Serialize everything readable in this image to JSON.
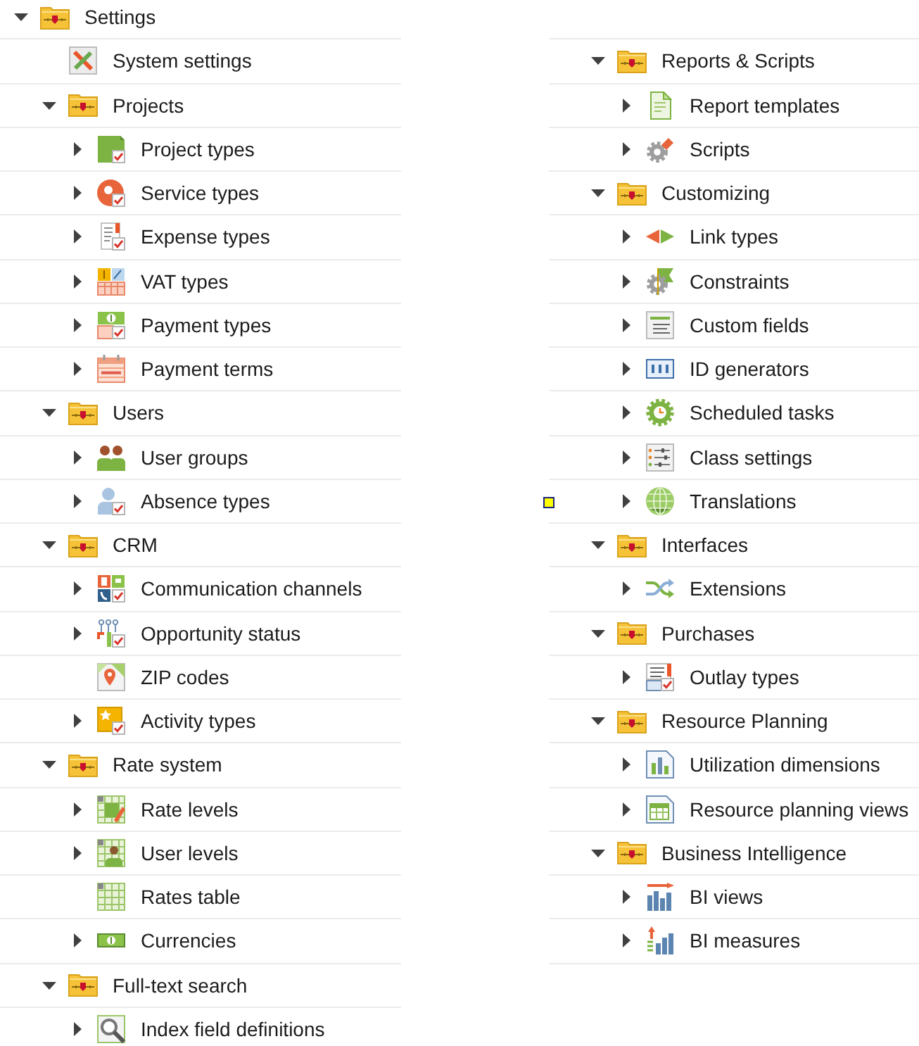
{
  "tree": {
    "label": "Settings",
    "kind": "folder",
    "expanded": true,
    "children": [
      {
        "label": "System settings",
        "kind": "tools"
      },
      {
        "label": "Projects",
        "kind": "folder",
        "expanded": true,
        "children": [
          {
            "label": "Project types",
            "kind": "tile",
            "expanded": false
          },
          {
            "label": "Service types",
            "kind": "pie",
            "expanded": false
          },
          {
            "label": "Expense types",
            "kind": "ledger",
            "expanded": false
          },
          {
            "label": "VAT types",
            "kind": "tax",
            "expanded": false
          },
          {
            "label": "Payment types",
            "kind": "payment",
            "expanded": false
          },
          {
            "label": "Payment terms",
            "kind": "calendar",
            "expanded": false
          }
        ]
      },
      {
        "label": "Users",
        "kind": "folder",
        "expanded": true,
        "children": [
          {
            "label": "User groups",
            "kind": "group",
            "expanded": false
          },
          {
            "label": "Absence types",
            "kind": "absence",
            "expanded": false
          }
        ]
      },
      {
        "label": "CRM",
        "kind": "folder",
        "expanded": true,
        "children": [
          {
            "label": "Communication channels",
            "kind": "channels",
            "expanded": false
          },
          {
            "label": "Opportunity status",
            "kind": "flow",
            "expanded": false
          },
          {
            "label": "ZIP codes",
            "kind": "map"
          },
          {
            "label": "Activity types",
            "kind": "star",
            "expanded": false
          }
        ]
      },
      {
        "label": "Rate system",
        "kind": "folder",
        "expanded": true,
        "children": [
          {
            "label": "Rate levels",
            "kind": "pencilgrid",
            "expanded": false
          },
          {
            "label": "User levels",
            "kind": "persongrid",
            "expanded": false
          },
          {
            "label": "Rates table",
            "kind": "grid"
          },
          {
            "label": "Currencies",
            "kind": "money",
            "expanded": false
          }
        ]
      },
      {
        "label": "Full-text search",
        "kind": "folder",
        "expanded": true,
        "children": [
          {
            "label": "Index field definitions",
            "kind": "magnifier",
            "expanded": false
          }
        ]
      },
      {
        "label": "Reports & Scripts",
        "kind": "folder",
        "expanded": true,
        "children": [
          {
            "label": "Report templates",
            "kind": "document",
            "expanded": false
          },
          {
            "label": "Scripts",
            "kind": "script",
            "expanded": false
          }
        ]
      },
      {
        "label": "Customizing",
        "kind": "folder",
        "expanded": true,
        "children": [
          {
            "label": "Link types",
            "kind": "link",
            "expanded": false
          },
          {
            "label": "Constraints",
            "kind": "constraint",
            "expanded": false
          },
          {
            "label": "Custom fields",
            "kind": "form",
            "expanded": false
          },
          {
            "label": "ID generators",
            "kind": "counter",
            "expanded": false
          },
          {
            "label": "Scheduled tasks",
            "kind": "schedule",
            "expanded": false
          },
          {
            "label": "Class settings",
            "kind": "sliders",
            "expanded": false
          },
          {
            "label": "Translations",
            "kind": "globe",
            "expanded": false
          }
        ]
      },
      {
        "label": "Interfaces",
        "kind": "folder",
        "expanded": true,
        "children": [
          {
            "label": "Extensions",
            "kind": "shuffle",
            "expanded": false
          }
        ]
      },
      {
        "label": "Purchases",
        "kind": "folder",
        "expanded": true,
        "children": [
          {
            "label": "Outlay types",
            "kind": "outlay",
            "expanded": false
          }
        ]
      },
      {
        "label": "Resource Planning",
        "kind": "folder",
        "expanded": true,
        "children": [
          {
            "label": "Utilization dimensions",
            "kind": "chart",
            "expanded": false
          },
          {
            "label": "Resource planning views",
            "kind": "planner",
            "expanded": false
          }
        ]
      },
      {
        "label": "Business Intelligence",
        "kind": "folder",
        "expanded": true,
        "children": [
          {
            "label": "BI views",
            "kind": "biview",
            "expanded": false
          },
          {
            "label": "BI measures",
            "kind": "bimeasure",
            "expanded": false
          }
        ]
      }
    ]
  }
}
